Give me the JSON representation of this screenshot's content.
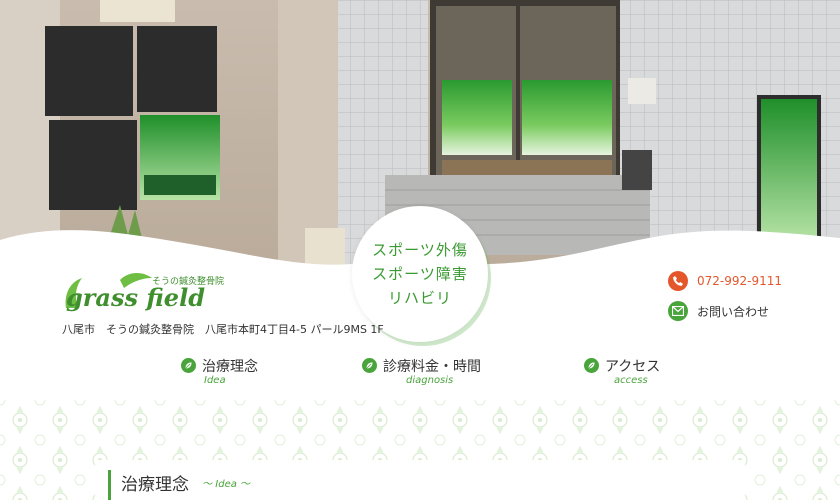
{
  "hero": {
    "bubble_lines": [
      "スポーツ外傷",
      "スポーツ障害",
      "リハビリ"
    ]
  },
  "logo": {
    "brand": "grass field",
    "tagline": "そうの鍼灸整骨院"
  },
  "address": "八尾市　そうの鍼灸整骨院　八尾市本町4丁目4-5 パール9MS 1F",
  "contact": {
    "phone": "072-992-9111",
    "inquiry": "お問い合わせ"
  },
  "nav": [
    {
      "label": "治療理念",
      "sub": "Idea"
    },
    {
      "label": "診療料金・時間",
      "sub": "diagnosis"
    },
    {
      "label": "アクセス",
      "sub": "access"
    }
  ],
  "section": {
    "title": "治療理念",
    "sub": "～ Idea ～"
  },
  "colors": {
    "accent_green": "#4aa43c",
    "phone_orange": "#e3572b",
    "bubble_text": "#3a9a31"
  },
  "icons": [
    "phone-icon",
    "mail-icon",
    "leaf-icon"
  ]
}
